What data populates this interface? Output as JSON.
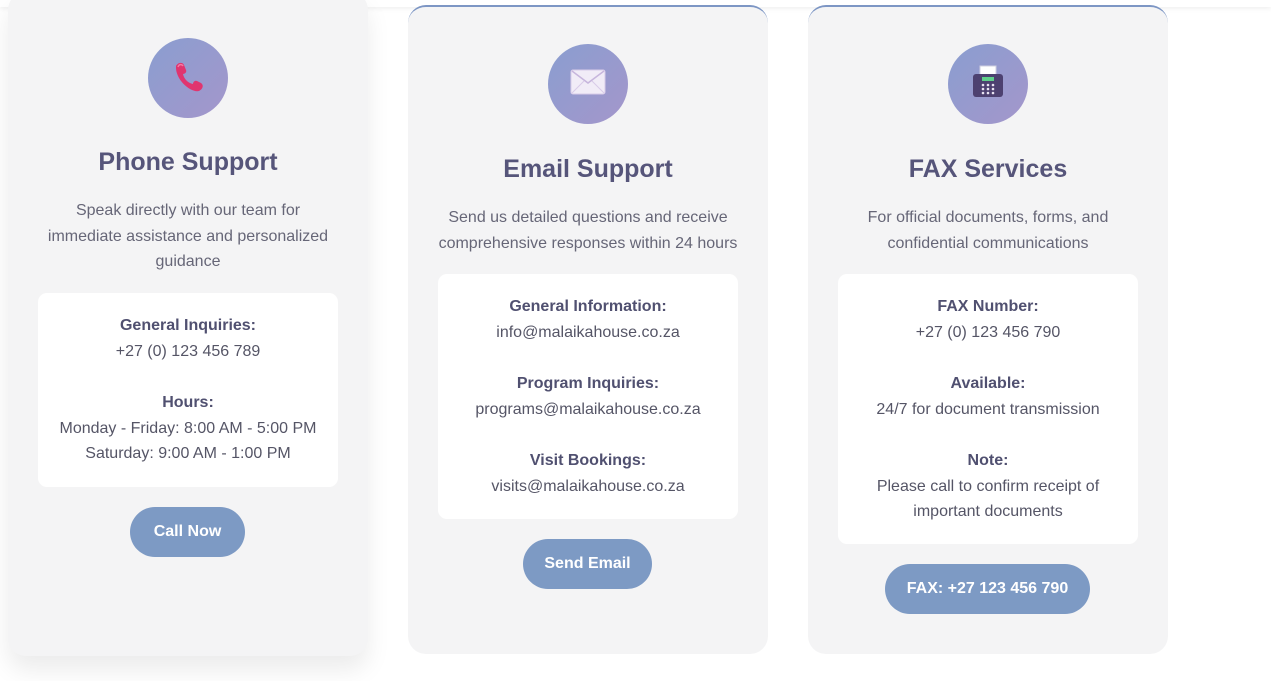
{
  "cards": [
    {
      "icon": "phone-icon",
      "title": "Phone Support",
      "description": "Speak directly with our team for immediate assistance and personalized guidance",
      "info": [
        {
          "label": "General Inquiries:",
          "value": "+27 (0) 123 456 789"
        },
        {
          "label": "Hours:",
          "value": "Monday - Friday: 8:00 AM - 5:00 PM",
          "value2": "Saturday: 9:00 AM - 1:00 PM"
        }
      ],
      "button": "Call Now"
    },
    {
      "icon": "envelope-icon",
      "title": "Email Support",
      "description": "Send us detailed questions and receive comprehensive responses within 24 hours",
      "info": [
        {
          "label": "General Information:",
          "value": "info@malaikahouse.co.za"
        },
        {
          "label": "Program Inquiries:",
          "value": "programs@malaikahouse.co.za"
        },
        {
          "label": "Visit Bookings:",
          "value": "visits@malaikahouse.co.za"
        }
      ],
      "button": "Send Email"
    },
    {
      "icon": "fax-machine-icon",
      "title": "FAX Services",
      "description": "For official documents, forms, and confidential communications",
      "info": [
        {
          "label": "FAX Number:",
          "value": "+27 (0) 123 456 790"
        },
        {
          "label": "Available:",
          "value": "24/7 for document transmission"
        },
        {
          "label": "Note:",
          "value": "Please call to confirm receipt of important documents"
        }
      ],
      "button": "FAX: +27 123 456 790"
    }
  ],
  "colors": {
    "card_bg": "#f4f4f5",
    "icon_gradient_start": "#8a9ed0",
    "icon_gradient_end": "#a496cb",
    "title": "#56557a",
    "button": "#7d9ac4"
  }
}
